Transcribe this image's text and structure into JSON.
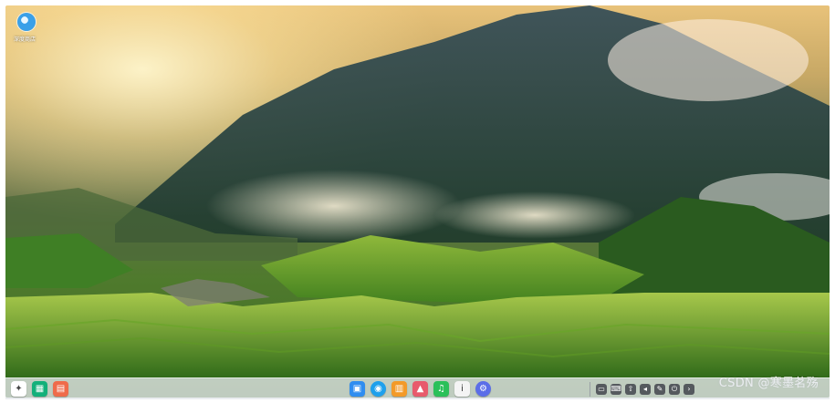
{
  "desktop": {
    "icon_label": "深度商店"
  },
  "dock": {
    "left_apps": [
      {
        "icon": "launcher-icon",
        "color": "#ffffff"
      },
      {
        "icon": "multitask-icon",
        "color": "#13b07a"
      },
      {
        "icon": "app-store-icon",
        "color": "#ef6b4b"
      }
    ],
    "center_apps": [
      {
        "icon": "file-manager-icon",
        "color": "#2f8df0"
      },
      {
        "icon": "browser-icon",
        "color": "#1ea0ec"
      },
      {
        "icon": "store-icon",
        "color": "#f39a29"
      },
      {
        "icon": "photos-icon",
        "color": "#e85a6c"
      },
      {
        "icon": "music-icon",
        "color": "#2bc05a"
      },
      {
        "icon": "notes-icon",
        "color": "#f4f4f4"
      },
      {
        "icon": "settings-icon",
        "color": "#5b6ee8"
      }
    ],
    "tray_items": [
      "screen-icon",
      "keyboard-icon",
      "usb-icon",
      "volume-icon",
      "edit-icon",
      "power-icon",
      "arrow-icon"
    ]
  },
  "watermark": "CSDN @寒墨茗殇"
}
